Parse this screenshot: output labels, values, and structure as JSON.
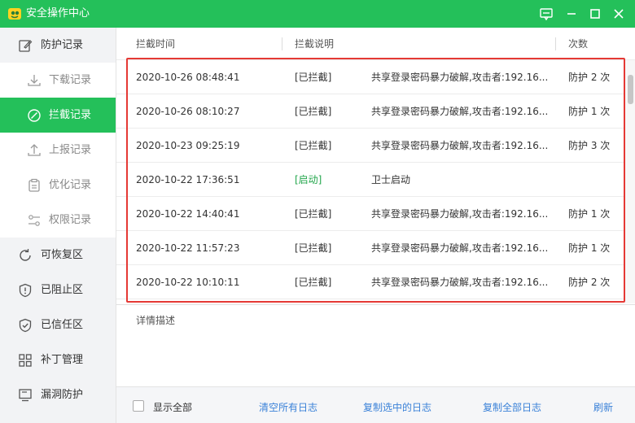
{
  "window": {
    "title": "安全操作中心",
    "logo_icon": "security-center-logo",
    "controls": [
      "feedback-icon",
      "minimize-icon",
      "maximize-icon",
      "close-icon"
    ]
  },
  "colors": {
    "accent": "#24c05a",
    "highlight_border": "#e53935",
    "link": "#3b82d8",
    "status_start": "#22a64b"
  },
  "sidebar": {
    "group": {
      "label": "防护记录",
      "icon": "edit-icon"
    },
    "sub_items": [
      {
        "label": "下载记录",
        "icon": "download-icon",
        "active": false
      },
      {
        "label": "拦截记录",
        "icon": "block-icon",
        "active": true
      },
      {
        "label": "上报记录",
        "icon": "upload-icon",
        "active": false
      },
      {
        "label": "优化记录",
        "icon": "clipboard-icon",
        "active": false
      },
      {
        "label": "权限记录",
        "icon": "permission-icon",
        "active": false
      }
    ],
    "items": [
      {
        "label": "可恢复区",
        "icon": "restore-icon"
      },
      {
        "label": "已阻止区",
        "icon": "shield-alert-icon"
      },
      {
        "label": "已信任区",
        "icon": "shield-check-icon"
      },
      {
        "label": "补丁管理",
        "icon": "grid-icon"
      },
      {
        "label": "漏洞防护",
        "icon": "monitor-icon"
      }
    ]
  },
  "table": {
    "headers": [
      "拦截时间",
      "拦截说明",
      "次数"
    ],
    "rows": [
      {
        "time": "2020-10-26 08:48:41",
        "status": "[已拦截]",
        "desc": "共享登录密码暴力破解,攻击者:192.16...",
        "count": "防护 2 次"
      },
      {
        "time": "2020-10-26 08:10:27",
        "status": "[已拦截]",
        "desc": "共享登录密码暴力破解,攻击者:192.16...",
        "count": "防护 1 次"
      },
      {
        "time": "2020-10-23 09:25:19",
        "status": "[已拦截]",
        "desc": "共享登录密码暴力破解,攻击者:192.16...",
        "count": "防护 3 次"
      },
      {
        "time": "2020-10-22 17:36:51",
        "status": "[启动]",
        "desc": "卫士启动",
        "count": ""
      },
      {
        "time": "2020-10-22 14:40:41",
        "status": "[已拦截]",
        "desc": "共享登录密码暴力破解,攻击者:192.16...",
        "count": "防护 1 次"
      },
      {
        "time": "2020-10-22 11:57:23",
        "status": "[已拦截]",
        "desc": "共享登录密码暴力破解,攻击者:192.16...",
        "count": "防护 1 次"
      },
      {
        "time": "2020-10-22 10:10:11",
        "status": "[已拦截]",
        "desc": "共享登录密码暴力破解,攻击者:192.16...",
        "count": "防护 2 次"
      }
    ]
  },
  "detail": {
    "title": "详情描述"
  },
  "footer": {
    "show_all_label": "显示全部",
    "show_all_checked": false,
    "clear_all": "清空所有日志",
    "copy_selected": "复制选中的日志",
    "copy_all": "复制全部日志",
    "refresh": "刷新"
  }
}
